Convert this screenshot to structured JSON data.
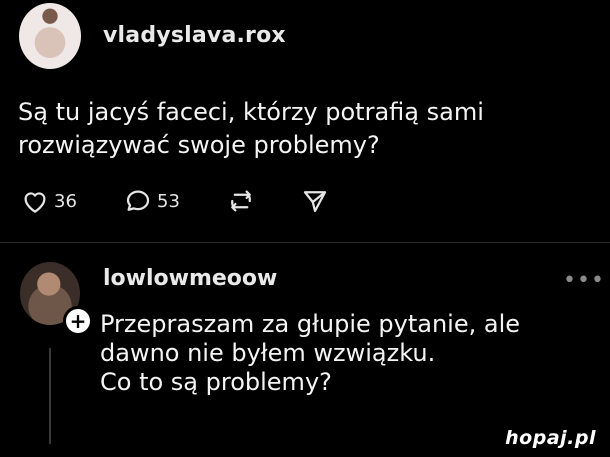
{
  "post": {
    "username": "vladyslava.rox",
    "text_lines": [
      "Są tu jacyś faceci, którzy potrafią sami",
      "rozwiązywać swoje problemy?"
    ],
    "likes": "36",
    "comments": "53"
  },
  "reply": {
    "username": "lowlowmeoow",
    "more_label": "•••",
    "add_label": "+",
    "text_lines": [
      "Przepraszam za głupie pytanie, ale",
      "dawno nie byłem wzwiązku.",
      "Co to są problemy?"
    ]
  },
  "watermark": "hopaj.pl",
  "icons": [
    "heart-icon",
    "comment-icon",
    "repost-icon",
    "send-icon",
    "more-icon",
    "plus-icon"
  ],
  "colors": {
    "background": "#000000",
    "text": "#f4f4f4",
    "muted": "#8a8a8a"
  }
}
